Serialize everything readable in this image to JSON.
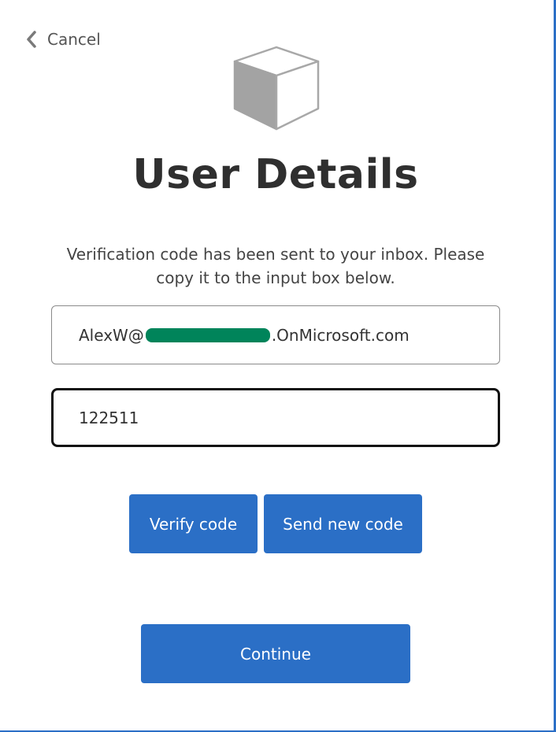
{
  "header": {
    "cancel_label": "Cancel",
    "logo_icon": "cube-icon"
  },
  "main": {
    "title": "User Details",
    "message": "Verification code has been sent to your inbox. Please copy it to the input box below.",
    "email": {
      "prefix": "AlexW@",
      "suffix": ".OnMicrosoft.com"
    },
    "code_value": "122511"
  },
  "buttons": {
    "verify_label": "Verify code",
    "send_new_label": "Send new code",
    "continue_label": "Continue"
  },
  "colors": {
    "accent": "#2b6fc6",
    "redaction": "#00845a",
    "title": "#2f2f2f"
  }
}
